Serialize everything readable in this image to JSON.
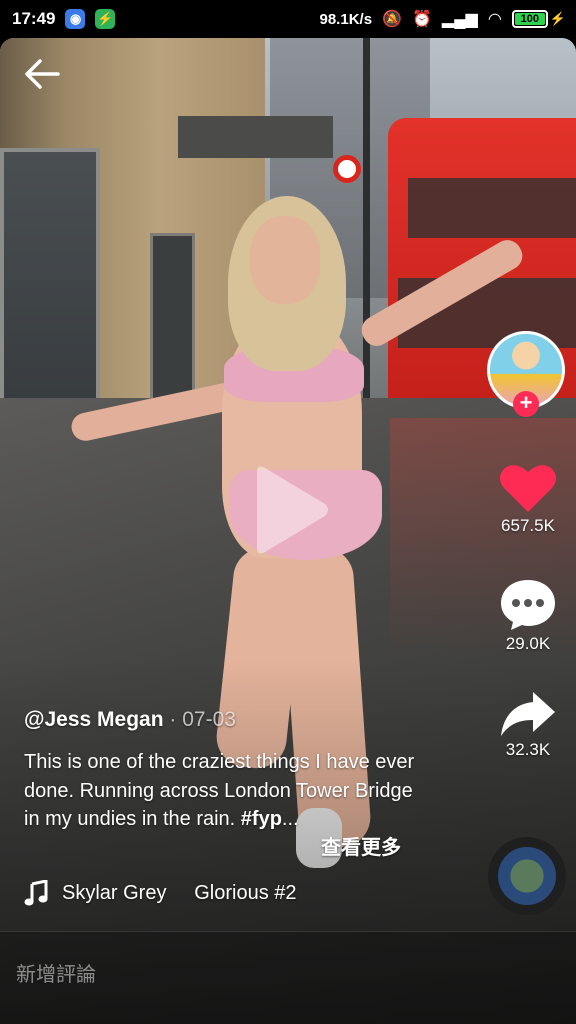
{
  "status_bar": {
    "time": "17:49",
    "network_speed": "98.1K/s",
    "battery": "100"
  },
  "video": {
    "play_icon": "play-icon"
  },
  "post": {
    "username": "@Jess Megan",
    "date": "· 07-03",
    "caption": "This is one of the craziest things I have ever done. Running across London Tower Bridge in my undies in the rain. ",
    "hashtag": "#fyp",
    "ellipsis": "...",
    "see_more": "查看更多"
  },
  "music": {
    "text": "Skylar Grey     Glorious #2",
    "icon": "music-note-icon"
  },
  "actions": {
    "likes": "657.5K",
    "comments": "29.0K",
    "shares": "32.3K"
  },
  "comment_bar": {
    "placeholder": "新增評論"
  },
  "colors": {
    "like_red": "#fe2c55",
    "battery_green": "#2fd14e"
  }
}
